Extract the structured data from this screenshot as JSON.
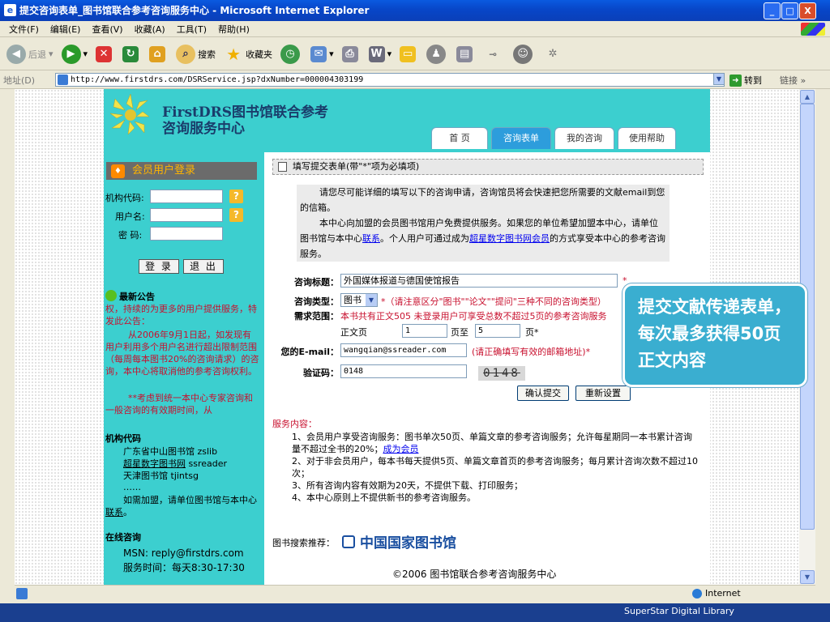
{
  "window": {
    "title": "提交咨询表单_图书馆联合参考咨询服务中心 - Microsoft Internet Explorer",
    "min": "_",
    "max": "□",
    "close": "X"
  },
  "menu": [
    "文件(F)",
    "编辑(E)",
    "查看(V)",
    "收藏(A)",
    "工具(T)",
    "帮助(H)"
  ],
  "toolbar": {
    "back": "后退",
    "search": "搜索",
    "favorites": "收藏夹"
  },
  "address": {
    "label": "地址(D)",
    "url": "http://www.firstdrs.com/DSRService.jsp?dxNumber=000004303199",
    "go": "转到",
    "links": "链接 »"
  },
  "header": {
    "title_line1": "FirstDRS图书馆联合参考",
    "title_line2": "咨询服务中心",
    "tabs": [
      {
        "label": "首  页",
        "active": false
      },
      {
        "label": "咨询表单",
        "active": true
      },
      {
        "label": "我的咨询",
        "active": false
      },
      {
        "label": "使用帮助",
        "active": false
      }
    ]
  },
  "left": {
    "login_title": "会员用户登录",
    "org_label": "机构代码:",
    "user_label": "用户名:",
    "pwd_label": "密  码:",
    "login_btn": "登 录",
    "logout_btn": "退 出",
    "announce_title": "最新公告",
    "announce_body": "权，持续的为更多的用户提供服务，特发此公告：",
    "announce_p1": "从2006年9月1日起，如发现有用户利用多个用户名进行超出限制范围（每周每本图书20%的咨询请求）的咨询，本中心将取消他的参考咨询权利。",
    "announce_p2": "**考虑到统一本中心专家咨询和一般咨询的有效期时间，从",
    "codes_title": "机构代码",
    "codes": [
      {
        "name": "广东省中山图书馆",
        "code": "zslib"
      },
      {
        "name": "超星数字图书网",
        "code": "ssreader"
      },
      {
        "name": "天津图书馆",
        "code": "tjintsg"
      }
    ],
    "ellipsis": "……",
    "join_text": "如需加盟，请单位图书馆与本中心",
    "join_link": "联系",
    "online_title": "在线咨询",
    "msn": "MSN: reply@firstdrs.com",
    "hours": "服务时间：每天8:30-17:30"
  },
  "form": {
    "head": "填写提交表单(带\"*\"项为必填项)",
    "intro1": "请您尽可能详细的填写以下的咨询申请，咨询馆员将会快速把您所需要的文献email到您的信箱。",
    "intro2a": "本中心向加盟的会员图书馆用户免费提供服务。如果您的单位希望加盟本中心，请单位图书馆与本中心",
    "intro2_link1": "联系",
    "intro2b": "。个人用户可通过成为",
    "intro2_link2": "超星数字图书网会员",
    "intro2c": "的方式享受本中心的参考咨询服务。",
    "title_label": "咨询标题：",
    "title_value": "外国媒体报道与德国使馆报告",
    "type_label": "咨询类型：",
    "type_value": "图书",
    "type_hint": "*（请注意区分\"图书\"\"论文\"\"提问\"三种不同的咨询类型）",
    "range_label": "需求范围：",
    "range_hint": "本书共有正文505 未登录用户可享受总数不超过5页的参考咨询服务",
    "page_label": "正文页",
    "page_from": "1",
    "page_to_label": "页至",
    "page_to": "5",
    "page_unit": "页*",
    "email_label": "您的E-mail：",
    "email_value": "wangqian@ssreader.com",
    "email_hint": "(请正确填写有效的邮箱地址)*",
    "captcha_label": "验证码：",
    "captcha_value": "0148",
    "captcha_image": "0148",
    "submit": "确认提交",
    "reset": "重新设置",
    "req": "*"
  },
  "service": {
    "title": "服务内容：",
    "items": [
      "1、会员用户享受咨询服务：图书单次50页、单篇文章的参考咨询服务；允许每星期同一本书累计咨询量不超过全书的20%；",
      "2、对于非会员用户，每本书每天提供5页、单篇文章首页的参考咨询服务；每月累计咨询次数不超过10次；",
      "3、所有咨询内容有效期为20天，不提供下载、打印服务；",
      "4、本中心原则上不提供新书的参考咨询服务。"
    ],
    "member_link": "成为会员"
  },
  "recommend": {
    "label": "图书搜索推荐：",
    "logo_text": "中国国家图书馆"
  },
  "copyright": "©2006 图书馆联合参考咨询服务中心",
  "status": {
    "zone": "Internet"
  },
  "callout": "提交文献传递表单，每次最多获得50页正文内容",
  "brand": "SuperStar Digital Library"
}
